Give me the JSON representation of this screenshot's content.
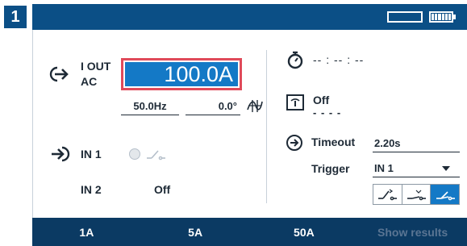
{
  "panel": {
    "number": "1"
  },
  "iout": {
    "label_line1": "I OUT",
    "label_line2": "AC",
    "value": "100.0A",
    "frequency": "50.0Hz",
    "phase": "0.0°"
  },
  "inputs": {
    "in1_label": "IN 1",
    "in2_label": "IN 2",
    "in2_value": "Off"
  },
  "timer": {
    "display": "-- : -- : --"
  },
  "output_state": {
    "value": "Off",
    "sub": "- - - -"
  },
  "timeout": {
    "label": "Timeout",
    "value": "2.20s"
  },
  "trigger": {
    "label": "Trigger",
    "value": "IN 1"
  },
  "bottom_bar": {
    "range_1": "1A",
    "range_2": "5A",
    "range_3": "50A",
    "show_results": "Show results"
  },
  "colors": {
    "header": "#0b4f86",
    "footer": "#0b3a63",
    "accent": "#1479c6",
    "focus_border": "#e04a5a"
  },
  "icons": {
    "output": "arrow-out-icon",
    "input": "arrow-in-icon",
    "timer": "stopwatch-icon",
    "display": "display-icon",
    "timeout": "timeout-arrow-icon",
    "phase": "phase-shift-icon",
    "battery": "battery-icon"
  },
  "trigger_modes": [
    "rising-edge",
    "falling-edge",
    "toggle"
  ],
  "active_trigger_mode": "toggle"
}
